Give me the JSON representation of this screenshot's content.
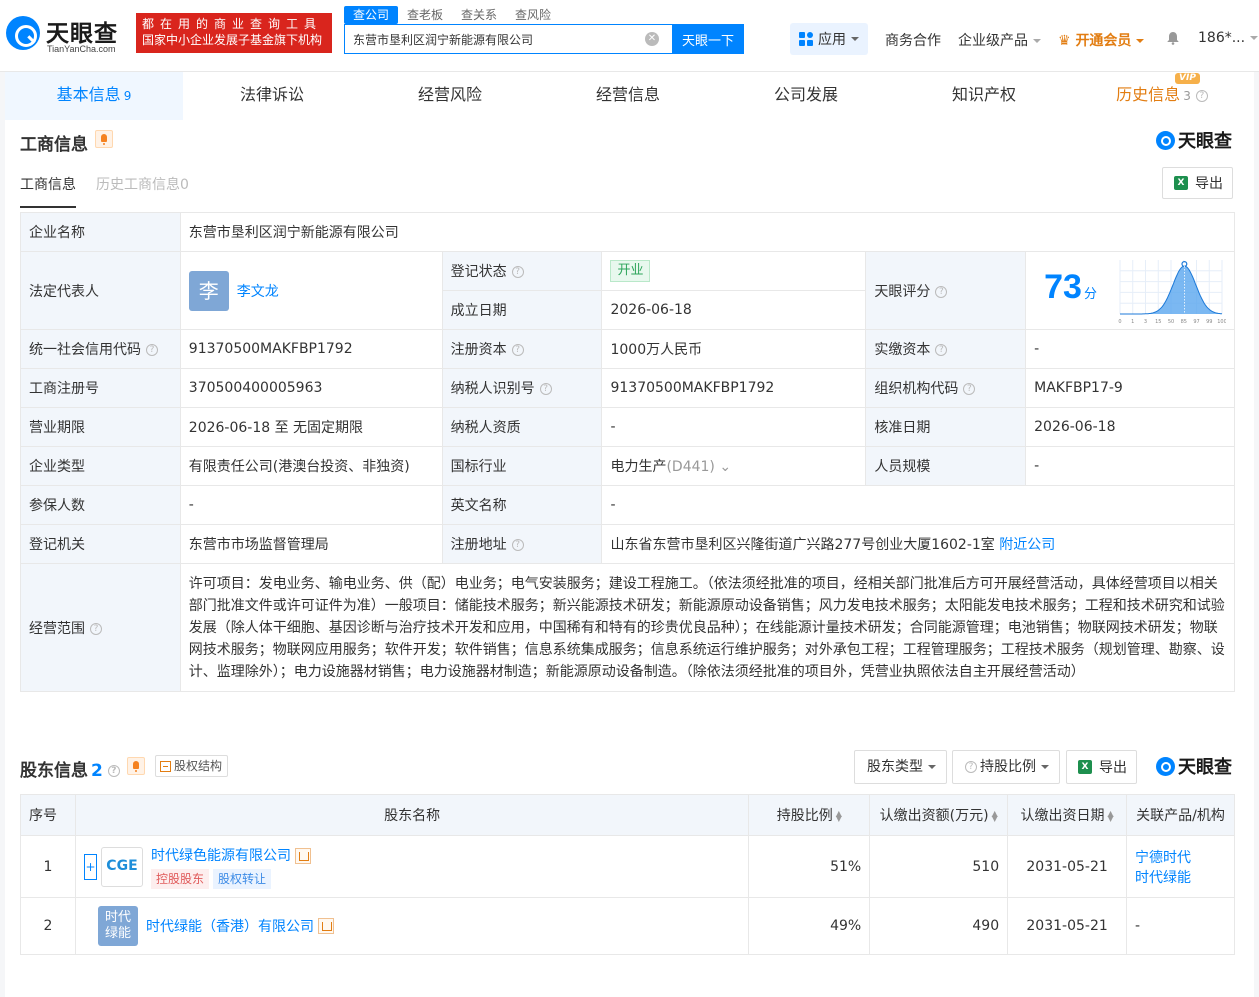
{
  "header": {
    "logo_name": "天眼查",
    "logo_sub": "TianYanCha.com",
    "slogan_line1": "都在用的商业查询工具",
    "slogan_line2": "国家中小企业发展子基金旗下机构",
    "search_tabs": [
      "查公司",
      "查老板",
      "查关系",
      "查风险"
    ],
    "search_value": "东营市垦利区润宁新能源有限公司",
    "search_button": "天眼一下",
    "apps_label": "应用",
    "business_label": "商务合作",
    "enterprise_label": "企业级产品",
    "vip_label": "开通会员",
    "user_label": "186*..."
  },
  "main_nav": [
    {
      "label": "基本信息",
      "count": "9"
    },
    {
      "label": "法律诉讼",
      "count": ""
    },
    {
      "label": "经营风险",
      "count": ""
    },
    {
      "label": "经营信息",
      "count": ""
    },
    {
      "label": "公司发展",
      "count": ""
    },
    {
      "label": "知识产权",
      "count": ""
    },
    {
      "label": "历史信息",
      "count": "3"
    }
  ],
  "vip_badge": "VIP",
  "business_info": {
    "title": "工商信息",
    "brand": "天眼查",
    "subtabs": [
      "工商信息",
      "历史工商信息0"
    ],
    "export_label": "导出",
    "rows": {
      "company_name_k": "企业名称",
      "company_name_v": "东营市垦利区润宁新能源有限公司",
      "legal_rep_k": "法定代表人",
      "legal_rep_avatar": "李",
      "legal_rep_v": "李文龙",
      "reg_status_k": "登记状态",
      "reg_status_v": "开业",
      "found_date_k": "成立日期",
      "found_date_v": "2026-06-18",
      "score_k": "天眼评分",
      "score_v": "73",
      "score_unit": "分",
      "credit_code_k": "统一社会信用代码",
      "credit_code_v": "91370500MAKFBP1792",
      "reg_capital_k": "注册资本",
      "reg_capital_v": "1000万人民币",
      "paid_capital_k": "实缴资本",
      "paid_capital_v": "-",
      "reg_no_k": "工商注册号",
      "reg_no_v": "370500400005963",
      "taxpayer_id_k": "纳税人识别号",
      "taxpayer_id_v": "91370500MAKFBP1792",
      "org_code_k": "组织机构代码",
      "org_code_v": "MAKFBP17-9",
      "term_k": "营业期限",
      "term_v": "2026-06-18 至 无固定期限",
      "taxpayer_qual_k": "纳税人资质",
      "taxpayer_qual_v": "-",
      "approve_date_k": "核准日期",
      "approve_date_v": "2026-06-18",
      "type_k": "企业类型",
      "type_v": "有限责任公司(港澳台投资、非独资)",
      "industry_k": "国标行业",
      "industry_v": "电力生产",
      "industry_code": "(D441)",
      "staff_k": "人员规模",
      "staff_v": "-",
      "insured_k": "参保人数",
      "insured_v": "-",
      "en_name_k": "英文名称",
      "en_name_v": "-",
      "authority_k": "登记机关",
      "authority_v": "东营市市场监督管理局",
      "address_k": "注册地址",
      "address_v": "山东省东营市垦利区兴隆街道广兴路277号创业大厦1602-1室",
      "nearby_link": "附近公司",
      "scope_k": "经营范围",
      "scope_v": "许可项目：发电业务、输电业务、供（配）电业务；电气安装服务；建设工程施工。（依法须经批准的项目，经相关部门批准后方可开展经营活动，具体经营项目以相关部门批准文件或许可证件为准）一般项目：储能技术服务；新兴能源技术研发；新能源原动设备销售；风力发电技术服务；太阳能发电技术服务；工程和技术研究和试验发展（除人体干细胞、基因诊断与治疗技术开发和应用，中国稀有和特有的珍贵优良品种）；在线能源计量技术研发；合同能源管理；电池销售；物联网技术研发；物联网技术服务；物联网应用服务；软件开发；软件销售；信息系统集成服务；信息系统运行维护服务；对外承包工程；工程管理服务；工程技术服务（规划管理、勘察、设计、监理除外）；电力设施器材销售；电力设施器材制造；新能源原动设备制造。（除依法须经批准的项目外，凭营业执照依法自主开展经营活动）"
    }
  },
  "shareholders": {
    "title": "股东信息",
    "count": "2",
    "equity_label": "股权结构",
    "filter_type": "股东类型",
    "filter_ratio": "持股比例",
    "export_label": "导出",
    "brand": "天眼查",
    "columns": [
      "序号",
      "股东名称",
      "持股比例",
      "认缴出资额(万元)",
      "认缴出资日期",
      "关联产品/机构"
    ],
    "rows": [
      {
        "no": "1",
        "logo": "CGE",
        "name": "时代绿色能源有限公司",
        "tag1": "控股股东",
        "tag2": "股权转让",
        "ratio": "51%",
        "amount": "510",
        "date": "2031-05-21",
        "related_1": "宁德时代",
        "related_2": "时代绿能"
      },
      {
        "no": "2",
        "logo_1": "时代",
        "logo_2": "绿能",
        "name": "时代绿能（香港）有限公司",
        "ratio": "49%",
        "amount": "490",
        "date": "2031-05-21",
        "related": "-"
      }
    ]
  },
  "chart_data": {
    "type": "area",
    "x_ticks": [
      "0",
      "1",
      "3",
      "15",
      "50",
      "85",
      "97",
      "99",
      "100"
    ],
    "marker_value": 73,
    "title": "",
    "xlabel": "",
    "ylabel": ""
  },
  "colors": {
    "accent": "#0084ff",
    "vip": "#e27d12",
    "slogan_bg": "#d9251d"
  }
}
